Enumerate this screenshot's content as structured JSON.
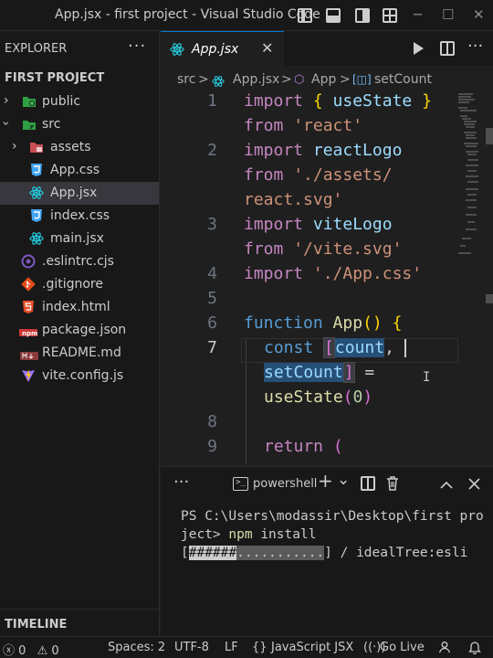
{
  "window": {
    "title": "App.jsx - first project - Visual Studio Code",
    "controls": {
      "minimize": "─",
      "maximize": "☐",
      "close": "✕"
    }
  },
  "sidebar": {
    "header": "EXPLORER",
    "more": "···",
    "project": "FIRST PROJECT",
    "items": [
      {
        "label": "public",
        "icon": "folder-public-icon",
        "expanded": false
      },
      {
        "label": "src",
        "icon": "folder-src-icon",
        "expanded": true
      },
      {
        "label": "assets",
        "icon": "folder-assets-icon",
        "expanded": false
      },
      {
        "label": "App.css",
        "icon": "css-file-icon"
      },
      {
        "label": "App.jsx",
        "icon": "react-file-icon",
        "selected": true
      },
      {
        "label": "index.css",
        "icon": "css-file-icon"
      },
      {
        "label": "main.jsx",
        "icon": "react-file-icon"
      },
      {
        "label": ".eslintrc.cjs",
        "icon": "eslint-file-icon"
      },
      {
        "label": ".gitignore",
        "icon": "git-file-icon"
      },
      {
        "label": "index.html",
        "icon": "html-file-icon"
      },
      {
        "label": "package.json",
        "icon": "npm-file-icon"
      },
      {
        "label": "README.md",
        "icon": "readme-file-icon"
      },
      {
        "label": "vite.config.js",
        "icon": "vite-file-icon"
      }
    ],
    "timeline": "TIMELINE"
  },
  "editor": {
    "tab": {
      "label": "App.jsx",
      "close": "✕"
    },
    "more": "···",
    "breadcrumb": {
      "folder": "src",
      "file": "App.jsx",
      "component": "App",
      "symbol": "setCount",
      "sep": ">"
    },
    "line_numbers": [
      "1",
      "2",
      "3",
      "4",
      "5",
      "6",
      "7",
      "8",
      "9"
    ],
    "code": {
      "l1a_kw": "import",
      "l1a_rest": " { ",
      "l1a_name": "useState",
      "l1a_end": " }",
      "l1b_kw": "from",
      "l1b_str": " 'react'",
      "l2a_kw": "import",
      "l2a_name": " reactLogo",
      "l2b_kw": "from",
      "l2b_str": " './assets/",
      "l2c_str": "react.svg'",
      "l3a_kw": "import",
      "l3a_name": " viteLogo",
      "l3b_kw": "from",
      "l3b_str": " '/vite.svg'",
      "l4_kw": "import",
      "l4_str": " './App.css'",
      "l6_kw": "function",
      "l6_fn": " App",
      "l6_paren": "()",
      "l6_brace": " {",
      "l7_kw": "const",
      "l7_bracket": "[",
      "l7_var": "count",
      "l7_comma": ",",
      "l7b_var": "setCount",
      "l7b_bracket": "]",
      "l7b_eq": " =",
      "l7c_fn": "useState",
      "l7c_open": "(",
      "l7c_num": "0",
      "l7c_close": ")",
      "l9_kw": "return",
      "l9_paren": " ("
    }
  },
  "terminal": {
    "more": "···",
    "shell": "powershell",
    "add": "+",
    "dropdown": "⌄",
    "prompt_line1": "PS C:\\Users\\modassir\\Desktop\\first pro",
    "prompt_line2_a": "ject> ",
    "prompt_line2_cmd": "npm",
    "prompt_line2_b": " install",
    "progress_open": "[",
    "progress_done": "######",
    "progress_rest": "...........",
    "progress_close": "]",
    "progress_status": " / idealTree:esli",
    "progress_fraction": 0.35
  },
  "statusbar": {
    "errors": "0",
    "warnings": "0",
    "spaces": "Spaces: 2",
    "encoding": "UTF-8",
    "eol": "LF",
    "language": "JavaScript JSX",
    "golive": "Go Live"
  },
  "colors": {
    "accent": "#0078d4",
    "keyword": "#569cd6",
    "control_keyword": "#c586c0",
    "string": "#ce9178",
    "function": "#dcdcaa",
    "variable": "#9cdcfe"
  }
}
